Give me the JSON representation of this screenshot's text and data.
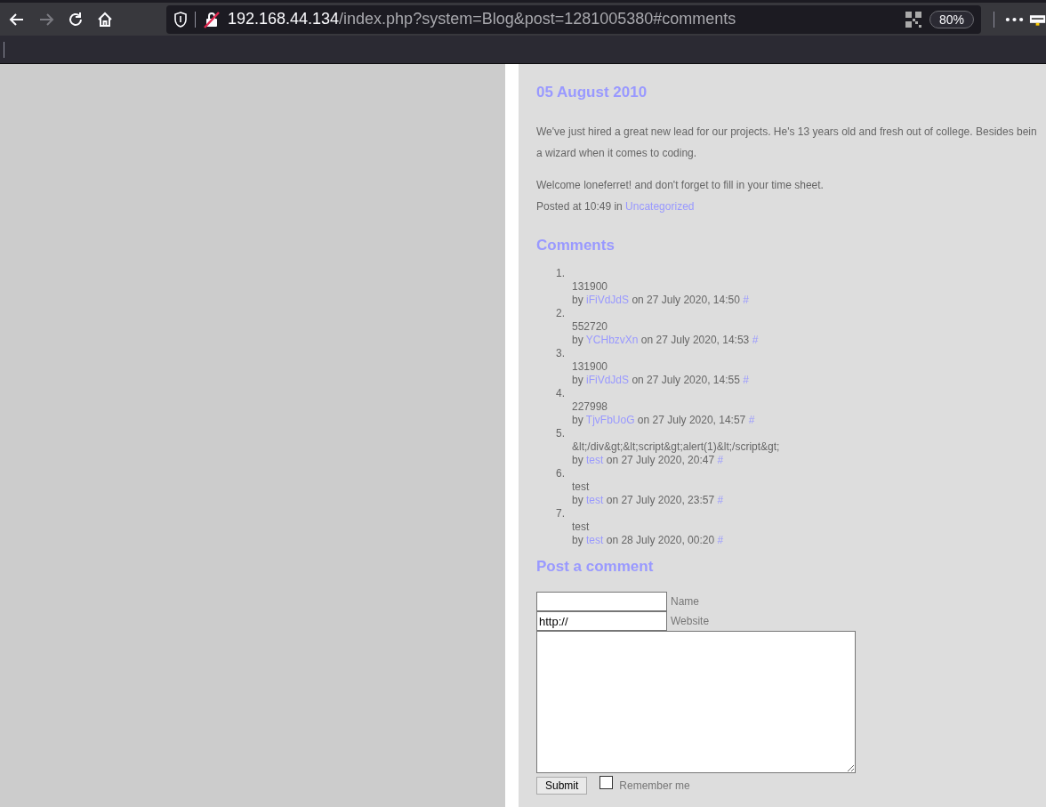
{
  "toolbar": {
    "url_host": "192.168.44.134",
    "url_rest": "/index.php?system=Blog&post=1281005380#comments",
    "zoom": "80%",
    "forward_disabled": true
  },
  "post": {
    "date": "05 August 2010",
    "body_lines": [
      "We've just hired a great new lead for our projects. He's 13 years old and fresh out of college. Besides bein",
      "a wizard when it comes to coding."
    ],
    "welcome": "Welcome loneferret! and don't forget to fill in your time sheet.",
    "posted_prefix": "Posted at 10:49 in",
    "category": "Uncategorized"
  },
  "comments": {
    "title": "Comments",
    "items": [
      {
        "number": "1.",
        "text": "131900",
        "by": "by",
        "author": "iFiVdJdS",
        "when": "on 27 July 2020, 14:50",
        "anchor": "#"
      },
      {
        "number": "2.",
        "text": "552720",
        "by": "by",
        "author": "YCHbzvXn",
        "when": "on 27 July 2020, 14:53",
        "anchor": "#"
      },
      {
        "number": "3.",
        "text": "131900",
        "by": "by",
        "author": "iFiVdJdS",
        "when": "on 27 July 2020, 14:55",
        "anchor": "#"
      },
      {
        "number": "4.",
        "text": "227998",
        "by": "by",
        "author": "TjvFbUoG",
        "when": "on 27 July 2020, 14:57",
        "anchor": "#"
      },
      {
        "number": "5.",
        "text": "&lt;/div&gt;&lt;script&gt;alert(1)&lt;/script&gt;",
        "by": "by",
        "author": "test",
        "when": "on 27 July 2020, 20:47",
        "anchor": "#"
      },
      {
        "number": "6.",
        "text": "test",
        "by": "by",
        "author": "test",
        "when": "on 27 July 2020, 23:57",
        "anchor": "#"
      },
      {
        "number": "7.",
        "text": "test",
        "by": "by",
        "author": "test",
        "when": "on 28 July 2020, 00:20",
        "anchor": "#"
      }
    ]
  },
  "form": {
    "title": "Post a comment",
    "name_label": "Name",
    "website_value": "http://",
    "website_label": "Website",
    "submit": "Submit",
    "remember_label": "Remember me",
    "remember_checked": false
  }
}
